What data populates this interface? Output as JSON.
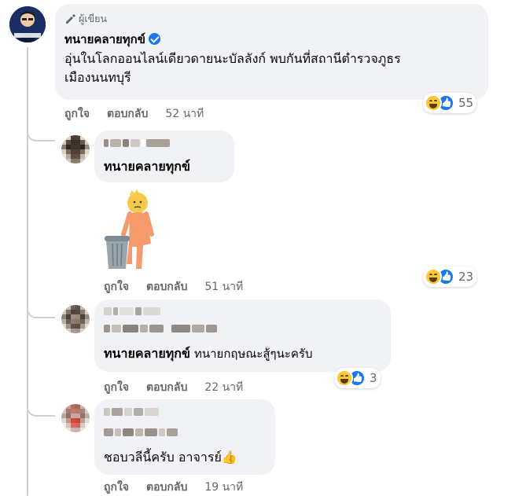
{
  "main_comment": {
    "badge_label": "ผู้เขียน",
    "author": "ทนายคลายทุกข์",
    "text_line1": "อุ่นในโลกออนไลน์เดียวดายนะบัลลังก์ พบกันที่สถานีตำรวจภูธร",
    "text_line2": "เมืองนนทบุรี",
    "like_label": "ถูกใจ",
    "reply_label": "ตอบกลับ",
    "time": "52 นาที",
    "reaction_count": "55"
  },
  "replies": [
    {
      "mention": "ทนายคลายทุกข์",
      "text": "",
      "has_sticker": true,
      "like_label": "ถูกใจ",
      "reply_label": "ตอบกลับ",
      "time": "51 นาที",
      "reaction_count": "23"
    },
    {
      "mention": "ทนายคลายทุกข์",
      "text": "ทนายกฤษณะสู้ๆนะครับ",
      "like_label": "ถูกใจ",
      "reply_label": "ตอบกลับ",
      "time": "22 นาที",
      "reaction_count": "3"
    },
    {
      "text": "ชอบวลีนี้ครับ อาจารย์👍",
      "like_label": "ถูกใจ",
      "reply_label": "ตอบกลับ",
      "time": "19 นาที"
    }
  ],
  "colors": {
    "bubble": "#f0f2f5",
    "verified": "#1877f2",
    "meta_text": "#65676b"
  }
}
